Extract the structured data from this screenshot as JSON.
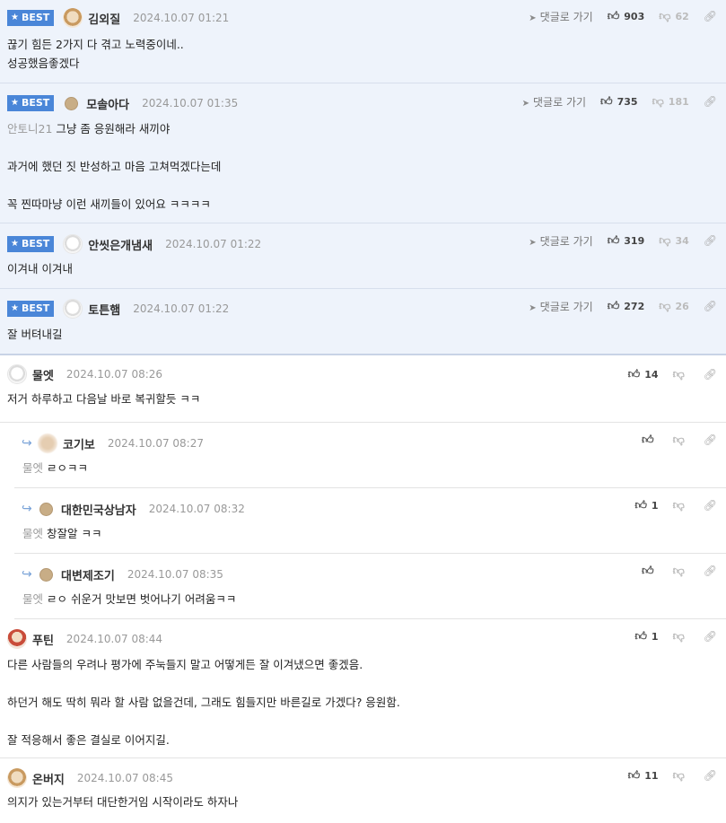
{
  "labels": {
    "best": "BEST",
    "goto": "댓글로 가기"
  },
  "comments": [
    {
      "nick": "김외질",
      "date": "2024.10.07 01:21",
      "up": "903",
      "down": "62",
      "lines": [
        "끊기 힘든 2가지 다 겪고 노력중이네..",
        "성공했음좋겠다"
      ]
    },
    {
      "nick": "모솔아다",
      "date": "2024.10.07 01:35",
      "up": "735",
      "down": "181",
      "mention": "안토니21",
      "lines": [
        "그냥 좀 응원해라 새끼야",
        "",
        "과거에 했던 짓 반성하고 마음 고쳐먹겠다는데",
        "",
        "꼭 찐따마냥 이런 새끼들이 있어요 ㅋㅋㅋㅋ"
      ]
    },
    {
      "nick": "안씻은개냄새",
      "date": "2024.10.07 01:22",
      "up": "319",
      "down": "34",
      "lines": [
        "이겨내 이겨내"
      ]
    },
    {
      "nick": "토튼햄",
      "date": "2024.10.07 01:22",
      "up": "272",
      "down": "26",
      "lines": [
        "잘 버텨내길"
      ]
    },
    {
      "nick": "물엣",
      "date": "2024.10.07 08:26",
      "up": "14",
      "down": "",
      "lines": [
        "저거 하루하고 다음날 바로 복귀할듯 ㅋㅋ"
      ]
    },
    {
      "nick": "코기보",
      "date": "2024.10.07 08:27",
      "up": "",
      "down": "",
      "mention": "물엣",
      "lines": [
        "ㄹㅇㅋㅋ"
      ]
    },
    {
      "nick": "대한민국상남자",
      "date": "2024.10.07 08:32",
      "up": "1",
      "down": "",
      "mention": "물엣",
      "lines": [
        "창잘알 ㅋㅋ"
      ]
    },
    {
      "nick": "대변제조기",
      "date": "2024.10.07 08:35",
      "up": "",
      "down": "",
      "mention": "물엣",
      "lines": [
        "ㄹㅇ 쉬운거 맛보면 벗어나기 어려움ㅋㅋ"
      ]
    },
    {
      "nick": "푸틴",
      "date": "2024.10.07 08:44",
      "up": "1",
      "down": "",
      "lines": [
        "다른 사람들의 우려나 평가에 주눅들지 말고 어떻게든 잘 이겨냈으면 좋겠음.",
        "",
        "하던거 해도 딱히 뭐라 할 사람 없을건데, 그래도 힘들지만 바른길로 가겠다? 응원함.",
        "",
        "잘 적응해서 좋은 결실로 이어지길."
      ]
    },
    {
      "nick": "온버지",
      "date": "2024.10.07 08:45",
      "up": "11",
      "down": "",
      "lines": [
        "의지가 있는거부터 대단한거임 시작이라도 하자나"
      ]
    }
  ]
}
